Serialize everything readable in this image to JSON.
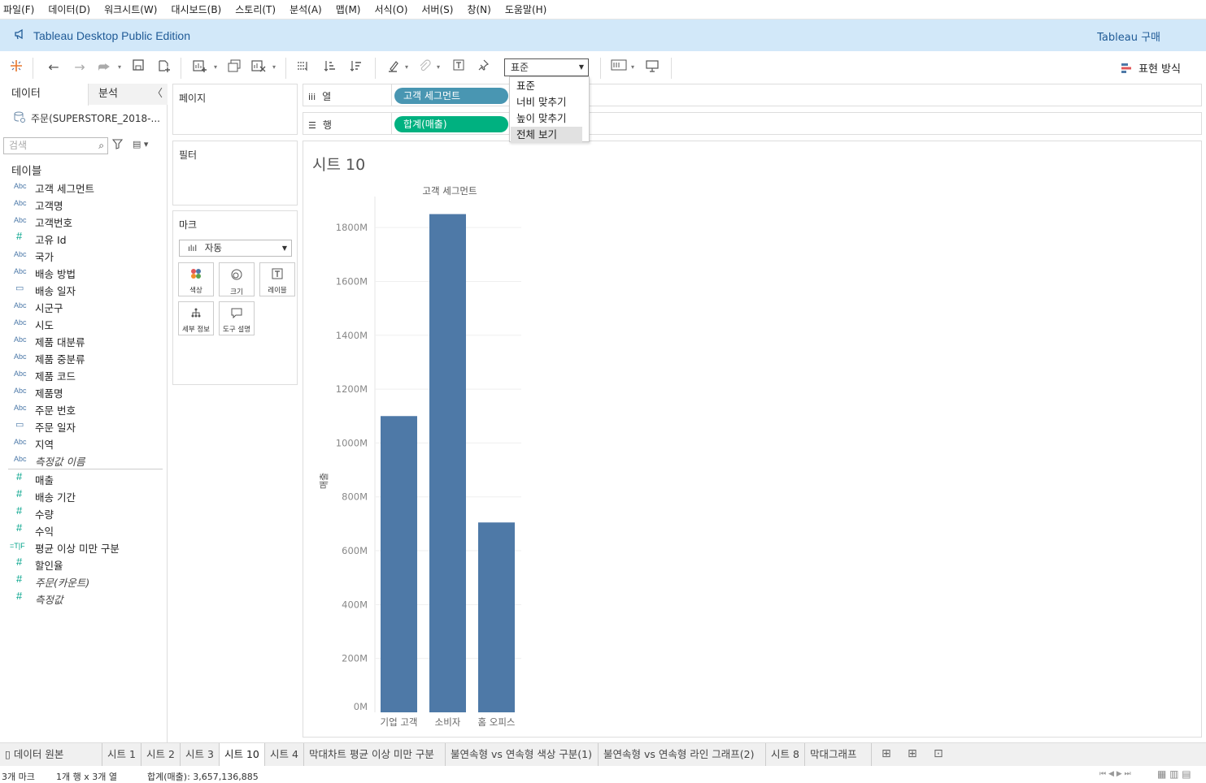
{
  "menu": [
    "파일(F)",
    "데이터(D)",
    "워크시트(W)",
    "대시보드(B)",
    "스토리(T)",
    "분석(A)",
    "맵(M)",
    "서식(O)",
    "서버(S)",
    "창(N)",
    "도움말(H)"
  ],
  "app": {
    "title": "Tableau Desktop Public Edition",
    "buy": "Tableau 구매"
  },
  "toolbar": {
    "fit_value": "표준",
    "show_me": "표현 방식",
    "fit_options": [
      "표준",
      "너비 맞추기",
      "높이 맞추기",
      "전체 보기"
    ],
    "fit_highlighted": "전체 보기"
  },
  "datapane": {
    "tab_data": "데이터",
    "tab_analysis": "분석",
    "datasource": "주문(SUPERSTORE_2018-...",
    "search_placeholder": "검색",
    "tables_label": "테이블",
    "dimensions": [
      {
        "type": "Abc",
        "name": "고객 세그먼트"
      },
      {
        "type": "Abc",
        "name": "고객명"
      },
      {
        "type": "Abc",
        "name": "고객번호"
      },
      {
        "type": "#",
        "name": "고유 Id"
      },
      {
        "type": "Abc",
        "name": "국가"
      },
      {
        "type": "Abc",
        "name": "배송 방법"
      },
      {
        "type": "date",
        "name": "배송 일자"
      },
      {
        "type": "Abc",
        "name": "시군구"
      },
      {
        "type": "Abc",
        "name": "시도"
      },
      {
        "type": "Abc",
        "name": "제품 대분류"
      },
      {
        "type": "Abc",
        "name": "제품 중분류"
      },
      {
        "type": "Abc",
        "name": "제품 코드"
      },
      {
        "type": "Abc",
        "name": "제품명"
      },
      {
        "type": "Abc",
        "name": "주문 번호"
      },
      {
        "type": "date",
        "name": "주문 일자"
      },
      {
        "type": "Abc",
        "name": "지역"
      },
      {
        "type": "Abc",
        "name": "측정값 이름",
        "italic": true
      }
    ],
    "measures": [
      {
        "type": "#",
        "name": "매출"
      },
      {
        "type": "#",
        "name": "배송 기간"
      },
      {
        "type": "#",
        "name": "수량"
      },
      {
        "type": "#",
        "name": "수익"
      },
      {
        "type": "=T|F",
        "name": "평균 이상 미만 구분"
      },
      {
        "type": "#",
        "name": "할인율"
      },
      {
        "type": "#",
        "name": "주문(카운트)",
        "italic": true
      },
      {
        "type": "#",
        "name": "측정값",
        "italic": true
      }
    ]
  },
  "cards": {
    "pages": "페이지",
    "filters": "필터",
    "marks": "마크",
    "mark_type": "자동",
    "mark_buttons": [
      "색상",
      "크기",
      "레이블",
      "세부 정보",
      "도구 설명"
    ]
  },
  "shelves": {
    "columns_label": "열",
    "rows_label": "행",
    "columns_pill": "고객 세그먼트",
    "rows_pill": "합계(매출)"
  },
  "colors": {
    "bar": "#4e79a7",
    "dim_pill": "#4996b2",
    "measure_pill": "#00b180",
    "title_bar": "#d2e8f9"
  },
  "view": {
    "sheet_title": "시트 10"
  },
  "chart_data": {
    "type": "bar",
    "title": "",
    "header": "고객 세그먼트",
    "categories": [
      "기업 고객",
      "소비자",
      "홈 오피스"
    ],
    "values": [
      1100,
      1850,
      705
    ],
    "ylabel": "매출",
    "yticks": [
      0,
      200,
      400,
      600,
      800,
      1000,
      1200,
      1400,
      1600,
      1800
    ],
    "ytick_suffix": "M",
    "ylim": [
      0,
      1900
    ],
    "grid": true
  },
  "sheet_tabs": [
    "데이터 원본",
    "시트 1",
    "시트 2",
    "시트 3",
    "시트 10",
    "시트 4",
    "막대차트 평균 이상 미만 구분",
    "불연속형 vs 연속형 색상 구분(1)",
    "불연속형 vs 연속형 라인 그래프(2)",
    "시트 8",
    "막대그래프"
  ],
  "active_tab": "시트 10",
  "status": {
    "marks": "3개 마크",
    "dims": "1개 행 x 3개 열",
    "sum": "합계(매출): 3,657,136,885"
  }
}
